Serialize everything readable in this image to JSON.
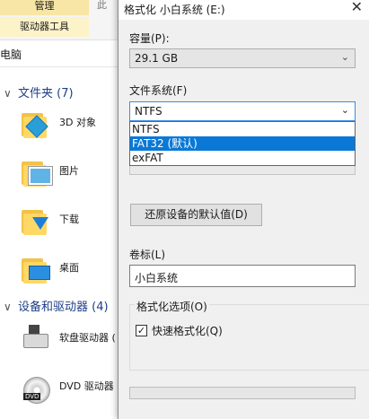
{
  "explorer": {
    "ribbon_tab_manage": "管理",
    "ribbon_tab_cut": "此",
    "ribbon_tab_drive_tools": "驱动器工具",
    "address": "电脑",
    "folders_group": "文件夹 (7)",
    "folders": [
      {
        "label": "3D 对象",
        "icon": "3d-objects-folder-icon"
      },
      {
        "label": "图片",
        "icon": "pictures-folder-icon"
      },
      {
        "label": "下载",
        "icon": "downloads-folder-icon"
      },
      {
        "label": "桌面",
        "icon": "desktop-folder-icon"
      }
    ],
    "devices_group": "设备和驱动器 (4)",
    "devices": [
      {
        "label": "软盘驱动器 (",
        "icon": "floppy-drive-icon"
      },
      {
        "label": "DVD 驱动器",
        "icon": "dvd-drive-icon"
      }
    ],
    "dvd_badge": "DVD"
  },
  "dialog": {
    "title": "格式化 小白系统 (E:)",
    "close_glyph": "✕",
    "capacity_label": "容量(P):",
    "capacity_value": "29.1 GB",
    "filesystem_label": "文件系统(F)",
    "filesystem_value": "NTFS",
    "filesystem_options": [
      "NTFS",
      "FAT32 (默认)",
      "exFAT"
    ],
    "filesystem_highlighted_index": 1,
    "restore_button": "还原设备的默认值(D)",
    "volume_label": "卷标(L)",
    "volume_value": "小白系统",
    "format_options_title": "格式化选项(O)",
    "quick_format_label": "快速格式化(Q)",
    "quick_format_checked": true,
    "checkmark": "✓",
    "arrow_glyph": "⌄"
  },
  "colors": {
    "selection": "#0a78d7",
    "ribbon_manage": "#f7e6a6",
    "focus_border": "#3c8de0"
  }
}
